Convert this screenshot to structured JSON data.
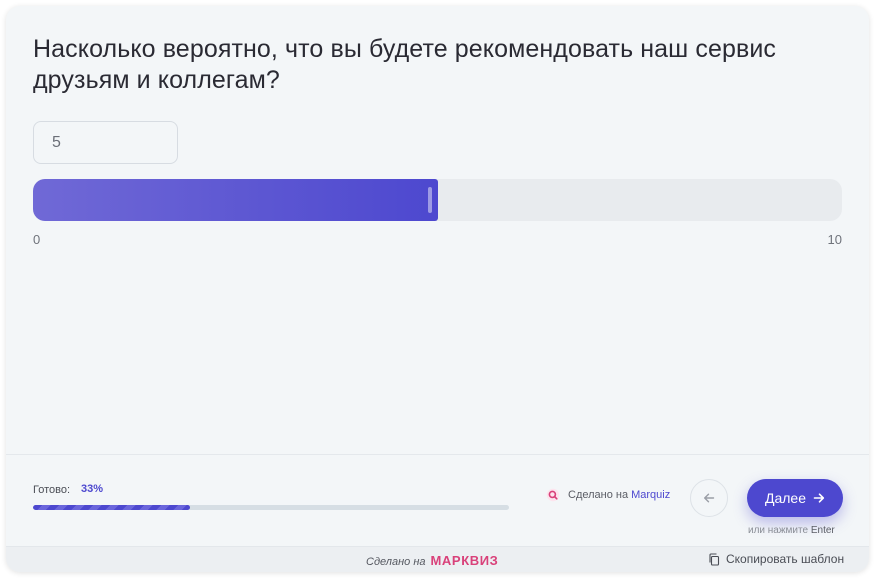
{
  "question": {
    "text": "Насколько вероятно, что вы будете рекомендовать наш сервис друзьям и коллегам?"
  },
  "slider": {
    "value": "5",
    "min_label": "0",
    "max_label": "10",
    "min": 0,
    "max": 10,
    "current": 5
  },
  "progress": {
    "label": "Готово:",
    "percent_text": "33%",
    "fraction": 0.33
  },
  "made_in": {
    "prefix": "Сделано на",
    "brand": "Marquiz",
    "icon": "marquiz-logo-icon"
  },
  "navigation": {
    "back_icon": "arrow-left-icon",
    "next_label": "Далее",
    "next_icon": "arrow-right-icon",
    "hint_prefix": "или нажмите",
    "hint_key": "Enter"
  },
  "footer": {
    "made_prefix": "Сделано на",
    "made_brand": "МАРКВИЗ",
    "copy_label": "Скопировать шаблон",
    "copy_icon": "copy-icon"
  },
  "colors": {
    "accent": "#4d48cf",
    "brand_pink": "#d9417a",
    "background": "#f3f6f8"
  }
}
